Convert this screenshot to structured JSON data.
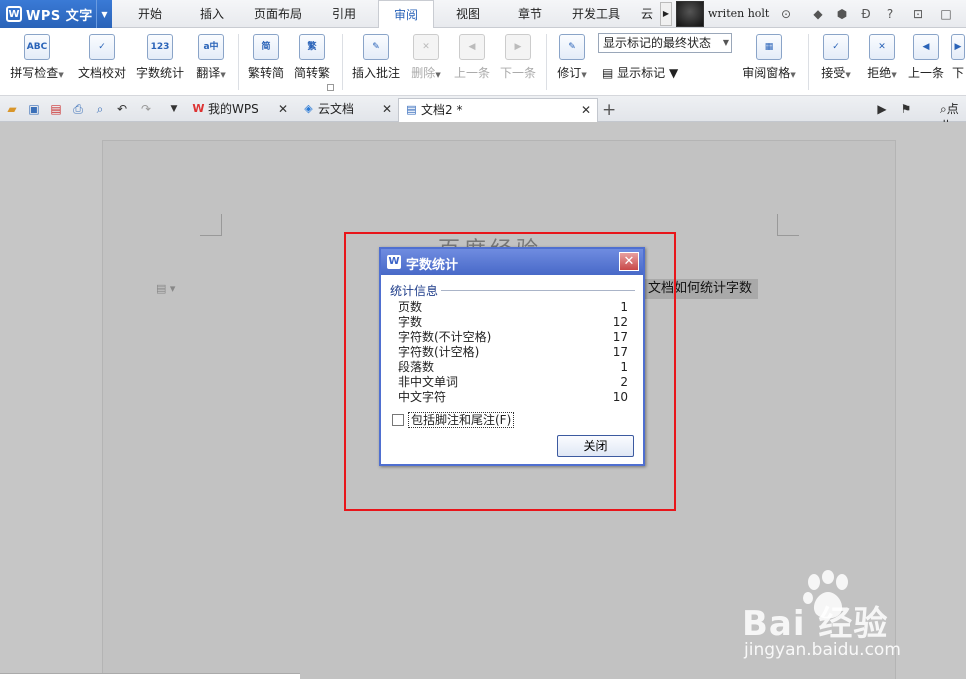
{
  "app": {
    "title": "WPS 文字",
    "logo": "W"
  },
  "menu": {
    "tabs": [
      "开始",
      "插入",
      "页面布局",
      "引用",
      "审阅",
      "视图",
      "章节",
      "开发工具",
      "云"
    ],
    "active": "审阅",
    "user_name": "writen holt"
  },
  "ribbon": {
    "spell_check": "拼写检查",
    "doc_compare": "文档校对",
    "word_count": "字数统计",
    "translate": "翻译",
    "trad_to_simp": "繁转简",
    "simp_to_trad": "简转繁",
    "insert_comment": "插入批注",
    "delete": "删除",
    "prev": "上一条",
    "next": "下一条",
    "track": "修订",
    "display_state": "显示标记的最终状态",
    "show_markup": "显示标记",
    "review_pane": "审阅窗格",
    "accept": "接受",
    "reject": "拒绝",
    "prev2": "上一条",
    "next2": "下",
    "icons": {
      "spell": "ABC",
      "word_count": "123",
      "trad": "简",
      "simp": "繁"
    }
  },
  "tabs": {
    "my_wps": "我的WPS",
    "cloud_docs": "云文档",
    "doc2": "文档2 *",
    "search_hint": "点此"
  },
  "document": {
    "heading": "百度经验",
    "line": "文档如何统计字数"
  },
  "dialog": {
    "title": "字数统计",
    "section": "统计信息",
    "stats": [
      {
        "label": "页数",
        "value": "1"
      },
      {
        "label": "字数",
        "value": "12"
      },
      {
        "label": "字符数(不计空格)",
        "value": "17"
      },
      {
        "label": "字符数(计空格)",
        "value": "17"
      },
      {
        "label": "段落数",
        "value": "1"
      },
      {
        "label": "非中文单词",
        "value": "2"
      },
      {
        "label": "中文字符",
        "value": "10"
      }
    ],
    "include_footnotes": "包括脚注和尾注(F)",
    "include_checked": false,
    "close": "关闭"
  },
  "watermark": {
    "brand": "Bai  经验",
    "url": "jingyan.baidu.com"
  },
  "colors": {
    "accent": "#2a63b8",
    "highlight_box": "#e8151a",
    "dialog_title": "#4869c8"
  }
}
